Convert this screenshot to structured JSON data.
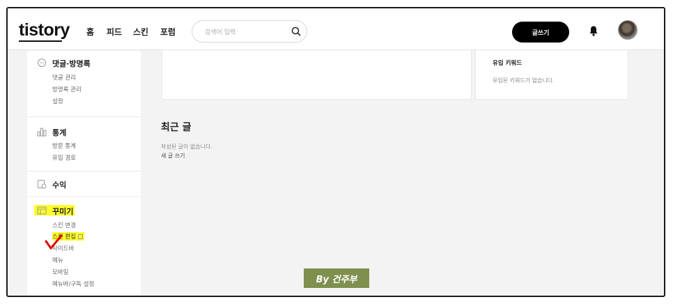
{
  "header": {
    "logo": "tistory",
    "nav": [
      "홈",
      "피드",
      "스킨",
      "포럼"
    ],
    "search_placeholder": "검색어 입력",
    "write_label": "글쓰기"
  },
  "sidebar": {
    "comments": {
      "title": "댓글·방명록",
      "items": [
        "댓글 관리",
        "방명록 관리",
        "설정"
      ]
    },
    "stats": {
      "title": "통계",
      "items": [
        "방문 통계",
        "유입 경로"
      ]
    },
    "revenue": {
      "title": "수익"
    },
    "decorate": {
      "title": "꾸미기",
      "items": [
        "스킨 변경",
        "스킨 편집",
        "사이드바",
        "메뉴",
        "모바일",
        "메뉴바/구독 설정"
      ]
    }
  },
  "main": {
    "keywords": {
      "title": "유입 키워드",
      "empty": "유입된 키워드가 없습니다."
    },
    "recent": {
      "title": "최근 글",
      "empty": "작성된 글이 없습니다.",
      "new_post": "새 글 쓰기"
    }
  },
  "watermark": "By 건주부",
  "colors": {
    "highlight": "#ffff2a",
    "check": "#e00000",
    "watermark_bg": "#7f8f4e"
  }
}
